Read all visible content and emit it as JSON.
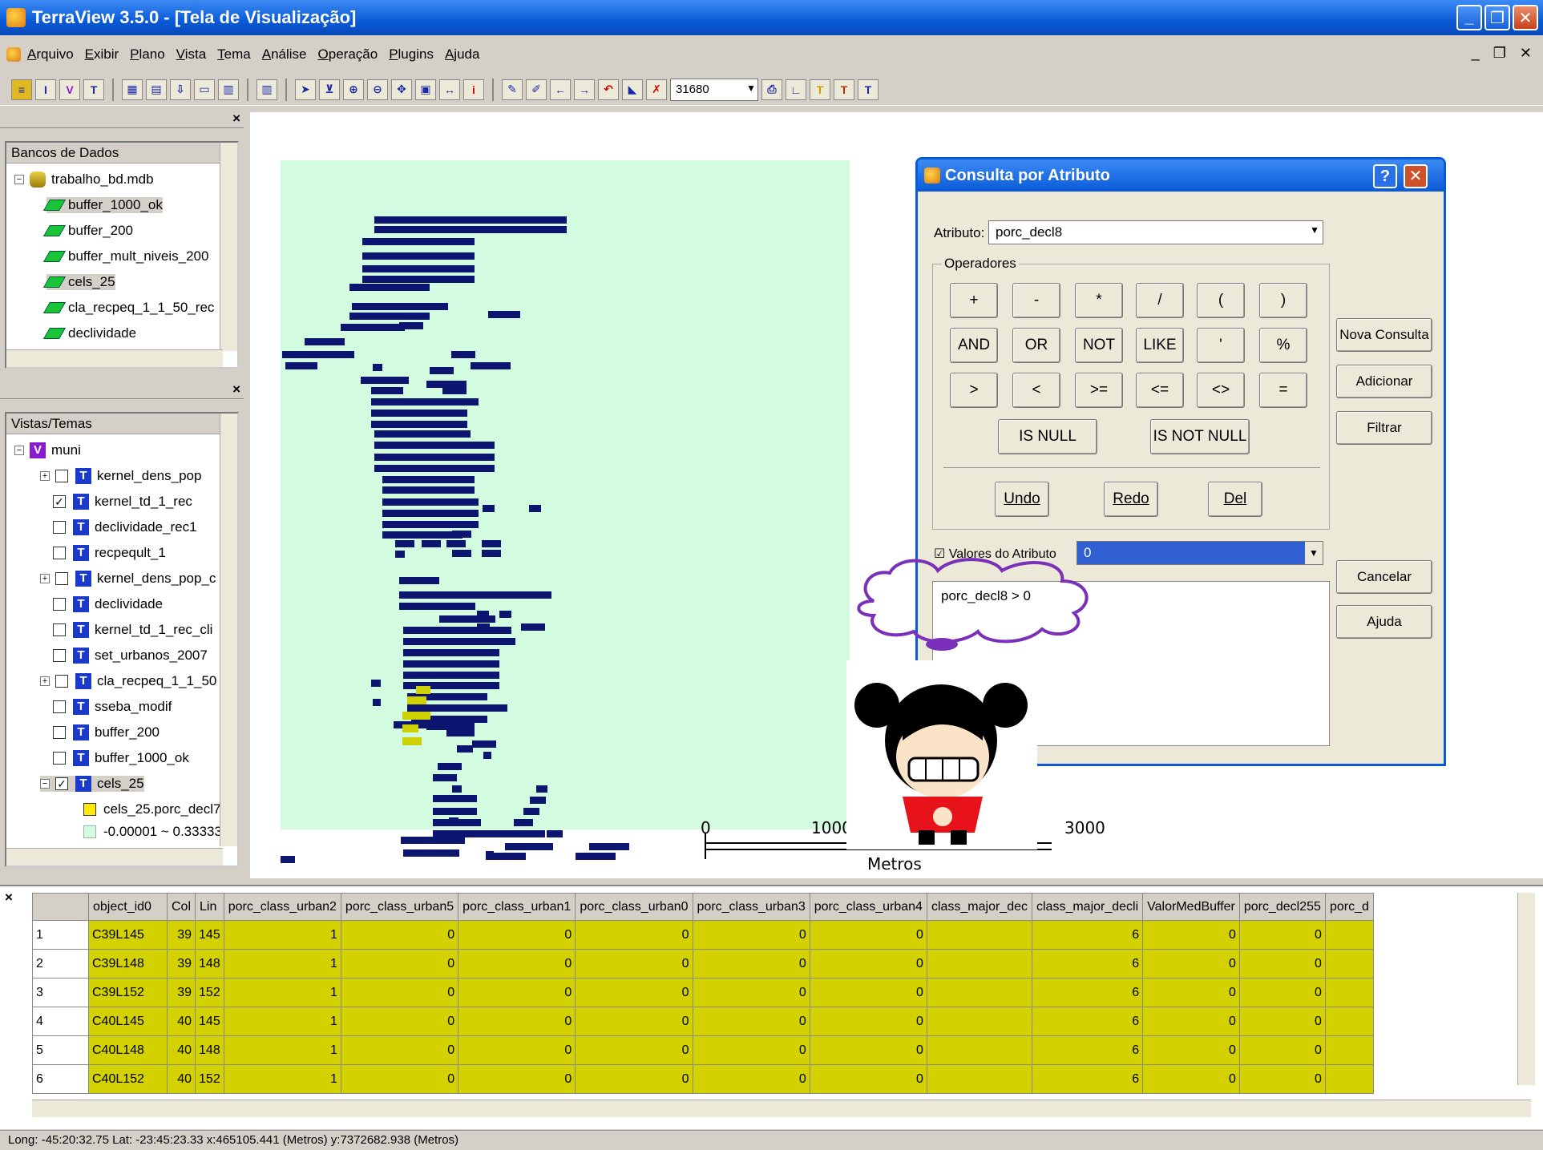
{
  "window": {
    "title": "TerraView 3.5.0 - [Tela de Visualização]"
  },
  "menu": [
    "Arquivo",
    "Exibir",
    "Plano",
    "Vista",
    "Tema",
    "Análise",
    "Operação",
    "Plugins",
    "Ajuda"
  ],
  "toolbar": {
    "zoom_value": "31680"
  },
  "db_panel": {
    "header": "Bancos de Dados",
    "db_name": "trabalho_bd.mdb",
    "layers": [
      "buffer_1000_ok",
      "buffer_200",
      "buffer_mult_niveis_200",
      "cels_25",
      "cla_recpeq_1_1_50_rec",
      "declividade"
    ]
  },
  "views_panel": {
    "header": "Vistas/Temas",
    "view_name": "muni",
    "themes": [
      {
        "name": "kernel_dens_pop",
        "checked": false
      },
      {
        "name": "kernel_td_1_rec",
        "checked": true
      },
      {
        "name": "declividade_rec1",
        "checked": false
      },
      {
        "name": "recpeqult_1",
        "checked": false
      },
      {
        "name": "kernel_dens_pop_c",
        "checked": false
      },
      {
        "name": "declividade",
        "checked": false
      },
      {
        "name": "kernel_td_1_rec_cli",
        "checked": false
      },
      {
        "name": "set_urbanos_2007",
        "checked": false
      },
      {
        "name": "cla_recpeq_1_1_50",
        "checked": false
      },
      {
        "name": "sseba_modif",
        "checked": false
      },
      {
        "name": "buffer_200",
        "checked": false
      },
      {
        "name": "buffer_1000_ok",
        "checked": false
      },
      {
        "name": "cels_25",
        "checked": true
      }
    ],
    "legend": [
      "cels_25.porc_decl7",
      "-0.00001 ~ 0.33333"
    ]
  },
  "scale": {
    "labels": [
      "0",
      "1000",
      "3000"
    ],
    "unit": "Metros"
  },
  "dialog": {
    "title": "Consulta por Atributo",
    "attr_label": "Atributo:",
    "attr_value": "porc_decl8",
    "operators_label": "Operadores",
    "operators": [
      "+",
      "-",
      "*",
      "/",
      "(",
      ")",
      "AND",
      "OR",
      "NOT",
      "LIKE",
      "'",
      "%",
      ">",
      "<",
      ">=",
      "<=",
      "<>",
      "="
    ],
    "is_null": "IS NULL",
    "is_not_null": "IS NOT NULL",
    "undo": "Undo",
    "redo": "Redo",
    "del": "Del",
    "values_label": "Valores do Atributo",
    "values_value": "0",
    "query_text": "porc_decl8 > 0",
    "side_buttons": [
      "Nova Consulta",
      "Adicionar",
      "Filtrar",
      "Cancelar",
      "Ajuda"
    ]
  },
  "grid": {
    "columns": [
      "",
      "object_id0",
      "Col",
      "Lin",
      "porc_class_urban2",
      "porc_class_urban5",
      "porc_class_urban1",
      "porc_class_urban0",
      "porc_class_urban3",
      "porc_class_urban4",
      "class_major_dec",
      "class_major_decli",
      "ValorMedBuffer",
      "porc_decl255",
      "porc_d"
    ],
    "rows": [
      [
        "1",
        "C39L145",
        "39",
        "145",
        "1",
        "0",
        "0",
        "0",
        "0",
        "0",
        "",
        "6",
        "0",
        "0",
        ""
      ],
      [
        "2",
        "C39L148",
        "39",
        "148",
        "1",
        "0",
        "0",
        "0",
        "0",
        "0",
        "",
        "6",
        "0",
        "0",
        ""
      ],
      [
        "3",
        "C39L152",
        "39",
        "152",
        "1",
        "0",
        "0",
        "0",
        "0",
        "0",
        "",
        "6",
        "0",
        "0",
        ""
      ],
      [
        "4",
        "C40L145",
        "40",
        "145",
        "1",
        "0",
        "0",
        "0",
        "0",
        "0",
        "",
        "6",
        "0",
        "0",
        ""
      ],
      [
        "5",
        "C40L148",
        "40",
        "148",
        "1",
        "0",
        "0",
        "0",
        "0",
        "0",
        "",
        "6",
        "0",
        "0",
        ""
      ],
      [
        "6",
        "C40L152",
        "40",
        "152",
        "1",
        "0",
        "0",
        "0",
        "0",
        "0",
        "",
        "6",
        "0",
        "0",
        ""
      ]
    ]
  },
  "status": "Long: -45:20:32.75 Lat: -23:45:23.33 x:465105.441 (Metros) y:7372682.938 (Metros)"
}
